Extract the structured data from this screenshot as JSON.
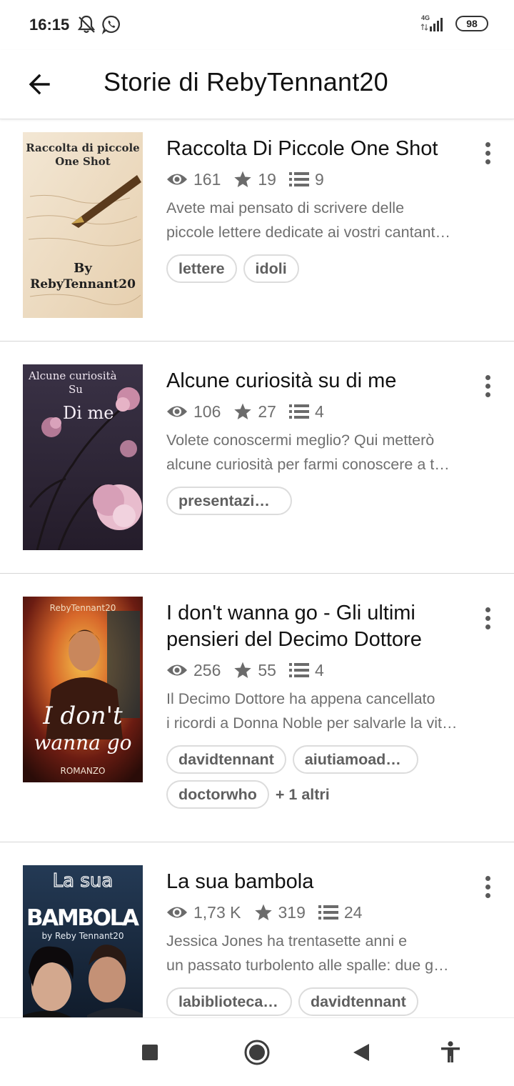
{
  "status_bar": {
    "time": "16:15",
    "network_label": "4G",
    "battery": "98",
    "icons": [
      "bell-off-icon",
      "whatsapp-icon",
      "signal-icon"
    ]
  },
  "header": {
    "title": "Storie di RebyTennant20",
    "back_icon": "arrow-left-icon"
  },
  "stories": [
    {
      "cover_text": [
        "Raccolta di piccole",
        "One Shot",
        "By",
        "RebyTennant20"
      ],
      "title": "Raccolta Di Piccole One Shot",
      "reads": "161",
      "votes": "19",
      "parts": "9",
      "description": [
        "Avete mai pensato di scrivere delle",
        "piccole lettere dedicate ai vostri cantant…"
      ],
      "tags": [
        "lettere",
        "idoli"
      ],
      "more_tags": ""
    },
    {
      "cover_text": [
        "Alcune curiosità",
        "Su",
        "Di me"
      ],
      "title": "Alcune curiosità su di me",
      "reads": "106",
      "votes": "27",
      "parts": "4",
      "description": [
        "Volete conoscermi meglio? Qui metterò",
        "alcune curiosità per farmi conoscere a t…"
      ],
      "tags": [
        "presentazi…"
      ],
      "more_tags": ""
    },
    {
      "cover_text": [
        "RebyTennant20",
        "I don't",
        "wanna go",
        "ROMANZO"
      ],
      "title": "I don't wanna go - Gli ultimi pensieri del Decimo Dottore",
      "reads": "256",
      "votes": "55",
      "parts": "4",
      "description": [
        "Il Decimo Dottore ha appena cancellato",
        "i ricordi a Donna Noble per salvarle la vit…"
      ],
      "tags": [
        "davidtennant",
        "aiutiamoad…",
        "doctorwho"
      ],
      "more_tags": "+ 1 altri"
    },
    {
      "cover_text": [
        "La sua",
        "BAMBOLA",
        "by Reby Tennant20"
      ],
      "title": "La sua bambola",
      "reads": "1,73 K",
      "votes": "319",
      "parts": "24",
      "description": [
        "Jessica Jones ha trentasette anni e",
        "un passato turbolento alle spalle: due g…"
      ],
      "tags": [
        "labiblioteca…",
        "davidtennant"
      ],
      "more_tags": ""
    }
  ],
  "nav_bar": {
    "icons": [
      "recents-square-icon",
      "home-circle-icon",
      "back-triangle-icon",
      "accessibility-icon"
    ]
  }
}
